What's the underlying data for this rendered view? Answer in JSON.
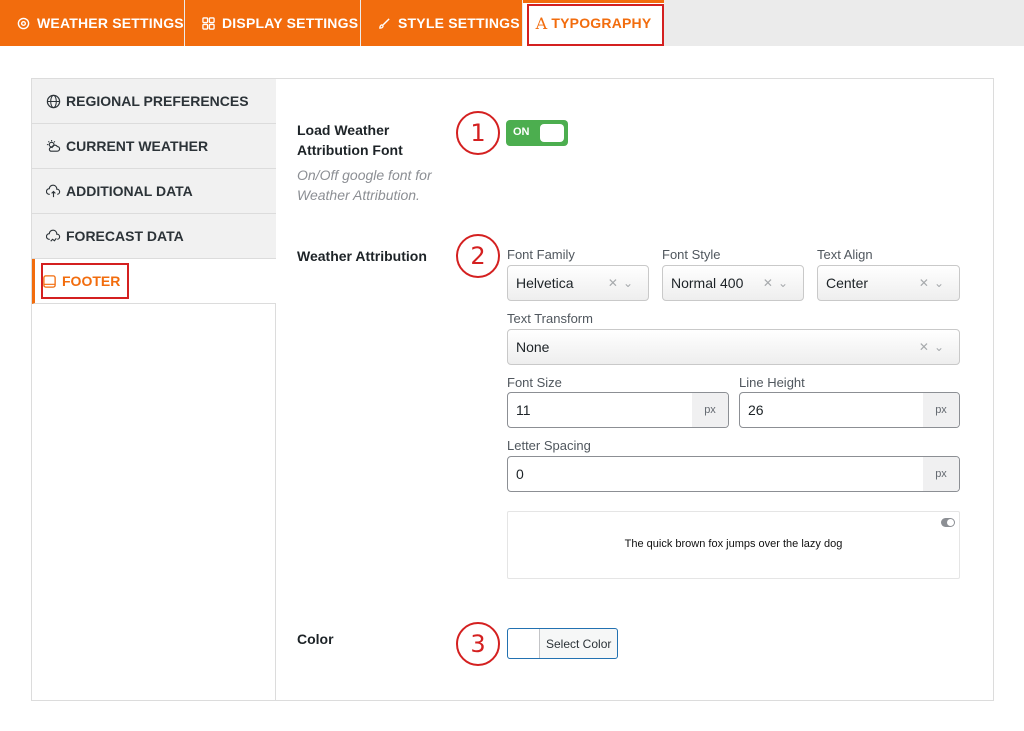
{
  "tabs": [
    {
      "label": "WEATHER SETTINGS",
      "icon": "weather-settings-icon"
    },
    {
      "label": "DISPLAY SETTINGS",
      "icon": "grid-icon"
    },
    {
      "label": "STYLE SETTINGS",
      "icon": "brush-icon"
    },
    {
      "label": "TYPOGRAPHY",
      "icon": "typography-icon",
      "active": true
    }
  ],
  "sidebar": {
    "items": [
      {
        "label": "REGIONAL PREFERENCES",
        "icon": "globe-icon"
      },
      {
        "label": "CURRENT WEATHER",
        "icon": "sun-cloud-icon"
      },
      {
        "label": "ADDITIONAL DATA",
        "icon": "cloud-upload-icon"
      },
      {
        "label": "FORECAST DATA",
        "icon": "cloud-chart-icon"
      },
      {
        "label": "FOOTER",
        "icon": "footer-icon",
        "active": true
      }
    ]
  },
  "settings": {
    "load_font": {
      "label": "Load Weather Attribution Font",
      "description": "On/Off google font for Weather Attribution.",
      "toggle": "ON"
    },
    "attribution": {
      "label": "Weather Attribution",
      "font_family": {
        "label": "Font Family",
        "value": "Helvetica"
      },
      "font_style": {
        "label": "Font Style",
        "value": "Normal 400"
      },
      "text_align": {
        "label": "Text Align",
        "value": "Center"
      },
      "text_transform": {
        "label": "Text Transform",
        "value": "None"
      },
      "font_size": {
        "label": "Font Size",
        "value": "11",
        "unit": "px"
      },
      "line_height": {
        "label": "Line Height",
        "value": "26",
        "unit": "px"
      },
      "letter_spacing": {
        "label": "Letter Spacing",
        "value": "0",
        "unit": "px"
      },
      "preview_text": "The quick brown fox jumps over the lazy dog"
    },
    "color": {
      "label": "Color",
      "button": "Select Color"
    }
  },
  "badges": [
    "1",
    "2",
    "3"
  ],
  "colors": {
    "accent": "#f26c0d",
    "annotation": "#d42020",
    "toggle_on": "#4cae4f"
  }
}
